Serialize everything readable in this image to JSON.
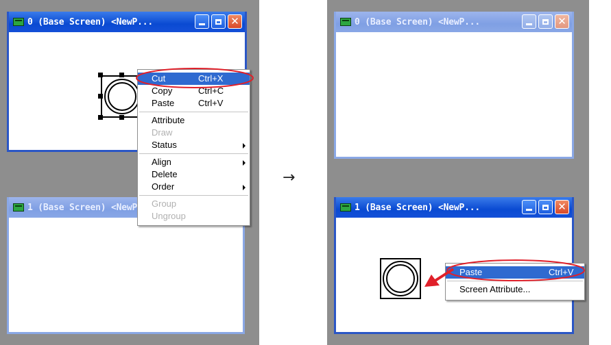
{
  "left": {
    "window0": {
      "title": "0 (Base Screen) <NewP..."
    },
    "window1": {
      "title": "1 (Base Screen) <NewP..."
    },
    "context_menu": {
      "items": [
        {
          "label": "Cut",
          "shortcut": "Ctrl+X"
        },
        {
          "label": "Copy",
          "shortcut": "Ctrl+C"
        },
        {
          "label": "Paste",
          "shortcut": "Ctrl+V"
        },
        {
          "label": "Attribute"
        },
        {
          "label": "Draw"
        },
        {
          "label": "Status"
        },
        {
          "label": "Align"
        },
        {
          "label": "Delete"
        },
        {
          "label": "Order"
        },
        {
          "label": "Group"
        },
        {
          "label": "Ungroup"
        }
      ]
    }
  },
  "arrow_symbol": "→",
  "right": {
    "window0": {
      "title": "0 (Base Screen) <NewP..."
    },
    "window1": {
      "title": "1 (Base Screen) <NewP..."
    },
    "context_menu": {
      "items": [
        {
          "label": "Paste",
          "shortcut": "Ctrl+V"
        },
        {
          "label": "Screen Attribute..."
        }
      ]
    }
  },
  "colors": {
    "highlight_oval": "#e0202a",
    "pointer_arrow": "#e0202a",
    "menu_highlight": "#2f6ad0"
  }
}
